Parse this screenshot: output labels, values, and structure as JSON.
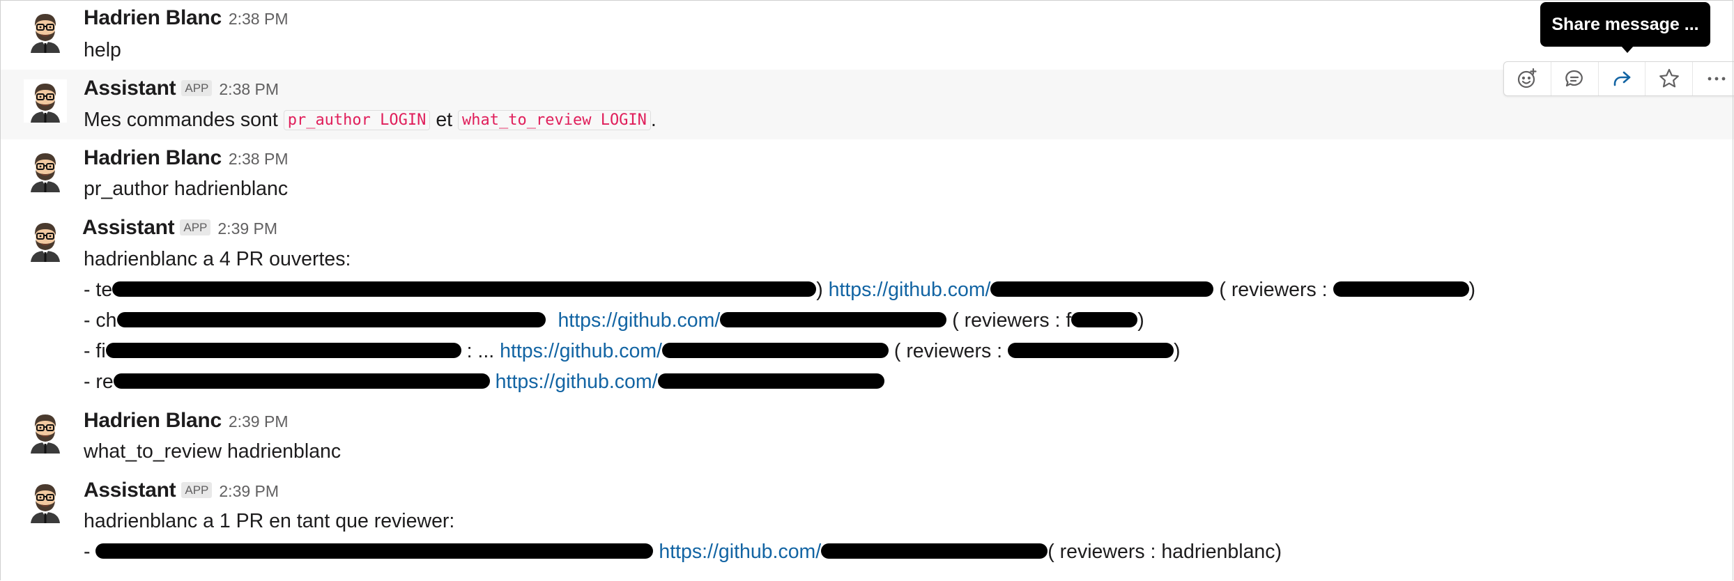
{
  "messages": {
    "m1": {
      "author": "Hadrien Blanc",
      "time": "2:38 PM",
      "text": "help"
    },
    "m2": {
      "author": "Assistant",
      "badge": "APP",
      "time": "2:38 PM",
      "text_before": "Mes commandes sont",
      "cmd1": "pr_author LOGIN",
      "text_between": "et",
      "cmd2": "what_to_review LOGIN",
      "text_after": "."
    },
    "m3": {
      "author": "Hadrien Blanc",
      "time": "2:38 PM",
      "text": "pr_author hadrienblanc"
    },
    "m4": {
      "author": "Assistant",
      "badge": "APP",
      "time": "2:39 PM",
      "intro": "hadrienblanc a 4 PR ouvertes:",
      "items": [
        {
          "prefix": "- te",
          "mid": ")",
          "link": "https://github.com/",
          "suffix": "( reviewers :",
          "tail": ")"
        },
        {
          "prefix": "- ch",
          "link": "https://github.com/",
          "suffix": "( reviewers :  f",
          "tail": ")"
        },
        {
          "prefix": "- fi",
          "mid": ": ...",
          "link": "https://github.com/",
          "suffix": "( reviewers :",
          "tail": ")"
        },
        {
          "prefix": "- re",
          "link": "https://github.com/"
        }
      ]
    },
    "m5": {
      "author": "Hadrien Blanc",
      "time": "2:39 PM",
      "text": "what_to_review hadrienblanc"
    },
    "m6": {
      "author": "Assistant",
      "badge": "APP",
      "time": "2:39 PM",
      "intro": "hadrienblanc a 1 PR en tant que reviewer:",
      "items": [
        {
          "prefix": "-",
          "link": "https://github.com/",
          "suffix": "( reviewers :  hadrienblanc)"
        }
      ]
    }
  },
  "toolbar": {
    "tooltip": "Share message ...",
    "actions": [
      "add-reaction-icon",
      "reply-thread-icon",
      "share-message-icon",
      "star-icon",
      "more-actions-icon"
    ],
    "accent": "#1264a3"
  },
  "colors": {
    "link": "#1264a3",
    "code": "#e01e5a"
  }
}
